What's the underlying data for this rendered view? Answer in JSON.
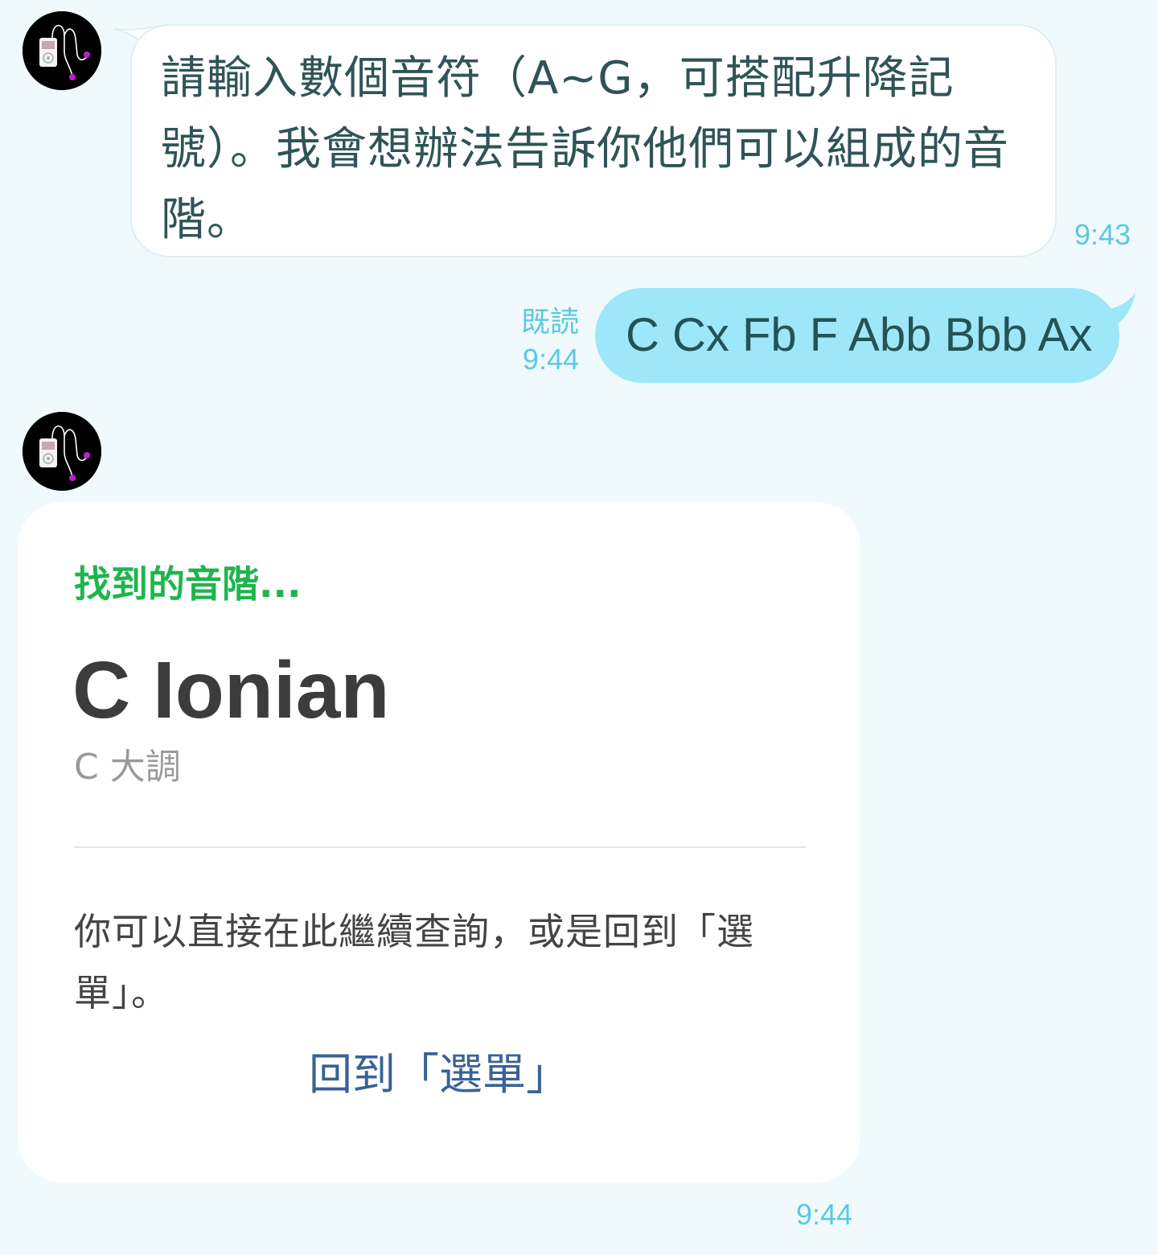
{
  "bot": {
    "avatar_icon": "ipod-earphones-icon"
  },
  "messages": {
    "first": {
      "text": "請輸入數個音符（A~G，可搭配升降記號）。我會想辦法告訴你他們可以組成的音階。",
      "time": "9:43"
    },
    "user": {
      "text": "C Cx Fb F Abb Bbb Ax",
      "read_label": "既読",
      "time": "9:44"
    },
    "card": {
      "heading": "找到的音階...",
      "title": "C Ionian",
      "subtitle": "C 大調",
      "body": "你可以直接在此繼續查詢，或是回到「選單」。",
      "link_label": "回到「選單」",
      "time": "9:44"
    }
  },
  "colors": {
    "background": "#f0fafd",
    "incoming_bubble": "#ffffff",
    "outgoing_bubble": "#9de7f8",
    "timestamp": "#5bc8e2",
    "heading_green": "#1fb54e",
    "link_blue": "#3a6296"
  }
}
